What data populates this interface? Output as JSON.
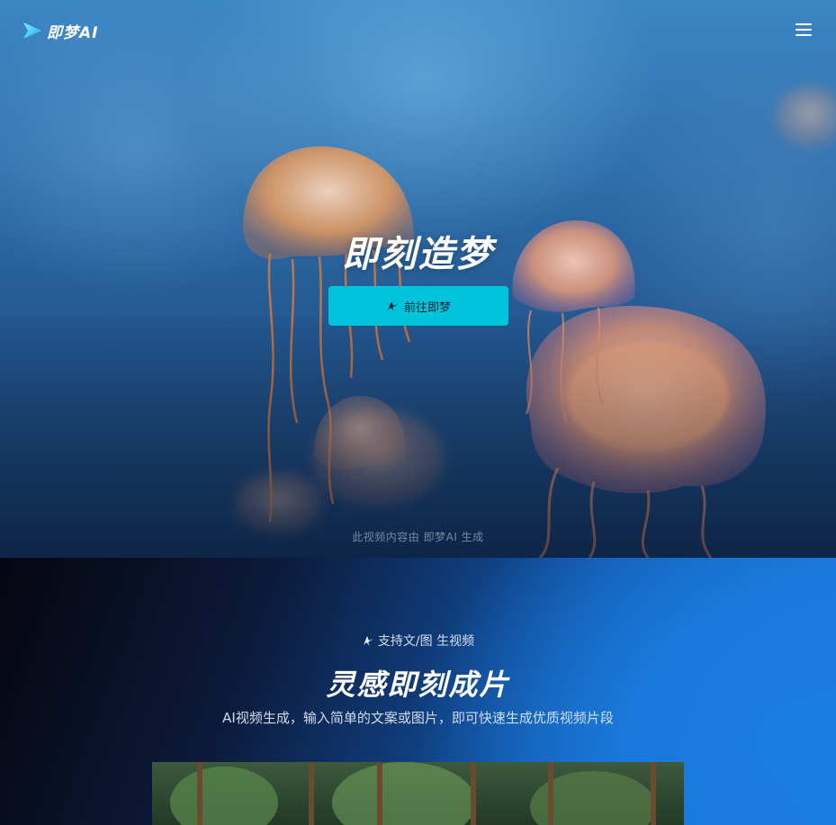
{
  "nav": {
    "logo_text": "即梦AI",
    "menu_icon": "hamburger-menu-icon"
  },
  "hero": {
    "title": "即刻造梦",
    "cta_label": "前往即梦",
    "cta_icon": "jimeng-logo-icon",
    "caption": "此视频内容由 即梦AI 生成",
    "colors": {
      "cta_bg": "#00c4dc",
      "background_ocean": "#2f6fac"
    }
  },
  "feature": {
    "tag_label": "支持文/图 生视频",
    "tag_icon": "jimeng-logo-icon",
    "title": "灵感即刻成片",
    "subtitle": "AI视频生成，输入简单的文案或图片，即可快速生成优质视频片段",
    "colors": {
      "accent_blue": "#1a7de0"
    }
  }
}
